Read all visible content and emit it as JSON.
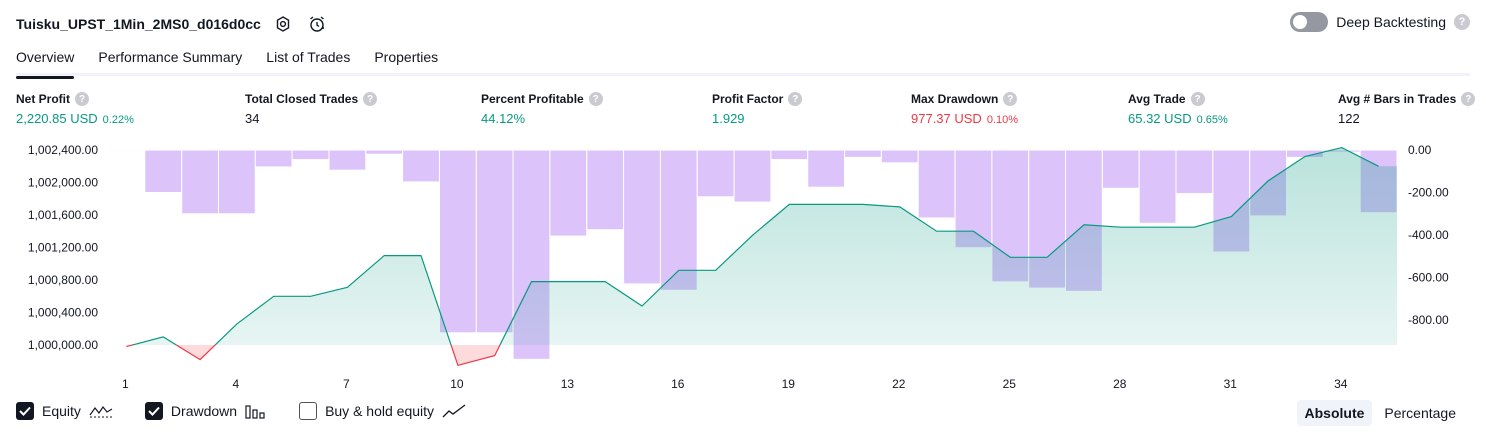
{
  "header": {
    "title": "Tuisku_UPST_1Min_2MS0_d016d0cc",
    "deep_backtesting_label": "Deep Backtesting",
    "help_glyph": "?"
  },
  "tabs": [
    {
      "label": "Overview",
      "active": true
    },
    {
      "label": "Performance Summary",
      "active": false
    },
    {
      "label": "List of Trades",
      "active": false
    },
    {
      "label": "Properties",
      "active": false
    }
  ],
  "metrics": [
    {
      "label": "Net Profit",
      "value": "2,220.85 USD",
      "pct": "0.22%",
      "color": "#089981"
    },
    {
      "label": "Total Closed Trades",
      "value": "34",
      "pct": "",
      "color": "#131722"
    },
    {
      "label": "Percent Profitable",
      "value": "44.12%",
      "pct": "",
      "color": "#089981"
    },
    {
      "label": "Profit Factor",
      "value": "1.929",
      "pct": "",
      "color": "#089981"
    },
    {
      "label": "Max Drawdown",
      "value": "977.37 USD",
      "pct": "0.10%",
      "color": "#f23645"
    },
    {
      "label": "Avg Trade",
      "value": "65.32 USD",
      "pct": "0.65%",
      "color": "#089981"
    },
    {
      "label": "Avg # Bars in Trades",
      "value": "122",
      "pct": "",
      "color": "#131722"
    }
  ],
  "chart_data": {
    "type": "area",
    "left_axis": {
      "ticks": [
        "1,002,400.00",
        "1,002,000.00",
        "1,001,600.00",
        "1,001,200.00",
        "1,000,800.00",
        "1,000,400.00",
        "1,000,000.00"
      ],
      "range": [
        1000000,
        1002400
      ]
    },
    "right_axis": {
      "ticks": [
        "0.00",
        "-200.00",
        "-400.00",
        "-600.00",
        "-800.00"
      ],
      "range": [
        -920,
        0
      ]
    },
    "x_ticks": [
      "1",
      "4",
      "7",
      "10",
      "13",
      "16",
      "19",
      "22",
      "25",
      "28",
      "31",
      "34"
    ],
    "x": [
      1,
      2,
      3,
      4,
      5,
      6,
      7,
      8,
      9,
      10,
      11,
      12,
      13,
      14,
      15,
      16,
      17,
      18,
      19,
      20,
      21,
      22,
      23,
      24,
      25,
      26,
      27,
      28,
      29,
      30,
      31,
      32,
      33,
      34,
      35
    ],
    "series": [
      {
        "name": "Equity",
        "values": [
          999980,
          1000100,
          999820,
          1000260,
          1000600,
          1000600,
          1000710,
          1001100,
          1001100,
          999750,
          999870,
          1000780,
          1000780,
          1000780,
          1000480,
          1000920,
          1000920,
          1001350,
          1001730,
          1001730,
          1001730,
          1001700,
          1001400,
          1001400,
          1001080,
          1001080,
          1001480,
          1001450,
          1001450,
          1001450,
          1001580,
          1002020,
          1002320,
          1002430,
          1002200
        ],
        "color": "#089981"
      },
      {
        "name": "Drawdown",
        "values": [
          -5,
          -200,
          -300,
          -300,
          -80,
          -45,
          -95,
          -20,
          -150,
          -860,
          -860,
          -985,
          -405,
          -375,
          -630,
          -660,
          -220,
          -245,
          -45,
          -175,
          -35,
          -60,
          -320,
          -460,
          -620,
          -650,
          -665,
          -180,
          -345,
          -205,
          -480,
          -310,
          -35,
          -10,
          -295
        ],
        "color": "#ce93d8"
      }
    ]
  },
  "legend": {
    "items": [
      {
        "label": "Equity",
        "checked": true
      },
      {
        "label": "Drawdown",
        "checked": true
      },
      {
        "label": "Buy & hold equity",
        "checked": false
      }
    ]
  },
  "mode": {
    "absolute_label": "Absolute",
    "percentage_label": "Percentage"
  }
}
